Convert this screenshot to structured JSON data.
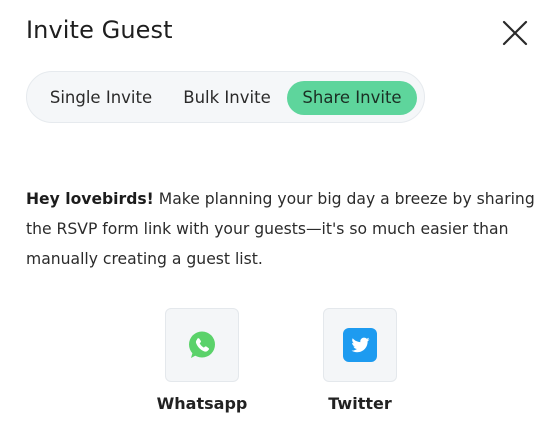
{
  "modal": {
    "title": "Invite Guest",
    "close_icon": "close-icon"
  },
  "tabs": [
    {
      "label": "Single Invite",
      "active": false
    },
    {
      "label": "Bulk Invite",
      "active": false
    },
    {
      "label": "Share Invite",
      "active": true
    }
  ],
  "description": {
    "lead": "Hey lovebirds!",
    "body": " Make planning your big day a breeze by sharing the RSVP form link with your guests—it's so much easier than manually creating a guest list."
  },
  "share_options": [
    {
      "label": "Whatsapp",
      "icon": "whatsapp-icon",
      "color": "#5bd26a"
    },
    {
      "label": "Twitter",
      "icon": "twitter-icon",
      "color": "#1d9bf0"
    }
  ],
  "colors": {
    "accent": "#5ed59c",
    "tab_bar_bg": "#f5f7f9",
    "share_box_bg": "#f4f6f8"
  }
}
